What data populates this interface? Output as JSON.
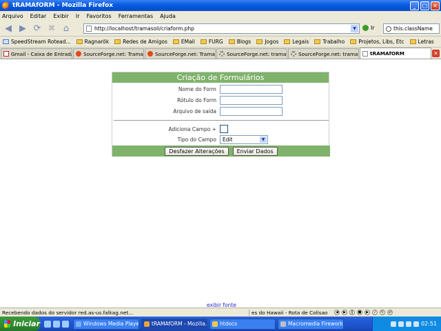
{
  "window": {
    "title": "tRAMAfORM - Mozilla Firefox"
  },
  "menu": [
    "Arquivo",
    "Editar",
    "Exibir",
    "Ir",
    "Favoritos",
    "Ferramentas",
    "Ajuda"
  ],
  "nav": {
    "url": "http://localhost/tramasoli/criaform.php",
    "go_label": "Ir",
    "search_value": "this.className"
  },
  "bookmarks": [
    "SpeedStream Rotead...",
    "Ragnarök",
    "Redes de Amigos",
    "EMail",
    "FURG",
    "Blogs",
    "Jogos",
    "Legais",
    "Trabalho",
    "Projetos, Libs, Etc",
    "Letras"
  ],
  "tabs": [
    {
      "label": "Gmail - Caixa de Entrada",
      "icon": "gmail-icon"
    },
    {
      "label": "SourceForge.net: Tramas...",
      "icon": "sourceforge-icon"
    },
    {
      "label": "SourceForge.net: Tramas...",
      "icon": "sourceforge-icon"
    },
    {
      "label": "SourceForge.net: tramaw...",
      "icon": "loading-icon"
    },
    {
      "label": "SourceForge.net: tramaw...",
      "icon": "loading-icon"
    },
    {
      "label": "tRAMAfORM",
      "icon": "page-icon"
    }
  ],
  "form": {
    "title": "Criação de Formulários",
    "fields": [
      {
        "label": "Nome do Form",
        "value": ""
      },
      {
        "label": "Rótulo do Form",
        "value": ""
      },
      {
        "label": "Arquivo de saída",
        "value": ""
      }
    ],
    "add_field_label": "Adiciona Campo +",
    "field_type_label": "Tipo do Campo",
    "field_type_value": "Edit",
    "reset_label": "Desfazer Alterações",
    "submit_label": "Enviar Dados"
  },
  "footer_link": "exibir fonte",
  "status": {
    "text": "Recebendo dados do servidor red.as-us.falkag.net...",
    "player": "es do Hawaii - Rota de Colisao"
  },
  "taskbar": {
    "start": "Iniciar",
    "tasks": [
      "Windows Media Player",
      "tRAMAfORM - Mozilla...",
      "htdocs",
      "Macromedia Firework..."
    ],
    "clock": "02:51"
  }
}
